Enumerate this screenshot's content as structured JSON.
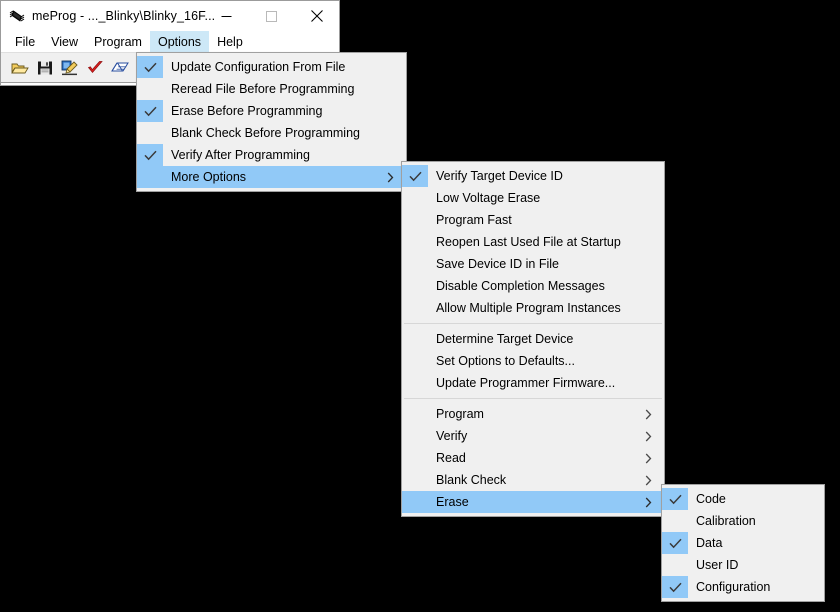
{
  "window": {
    "title": "meProg - ..._Blinky\\Blinky_16F...",
    "icon": "chip-icon",
    "controls": {
      "minimize": "minimize-icon",
      "maximize": "maximize-icon",
      "close": "close-icon"
    }
  },
  "menubar": {
    "items": [
      {
        "label": "File",
        "active": false
      },
      {
        "label": "View",
        "active": false
      },
      {
        "label": "Program",
        "active": false
      },
      {
        "label": "Options",
        "active": true
      },
      {
        "label": "Help",
        "active": false
      }
    ]
  },
  "toolbar": {
    "items": [
      {
        "name": "open-file-icon"
      },
      {
        "name": "save-file-icon"
      },
      {
        "name": "program-device-icon"
      },
      {
        "name": "verify-icon"
      },
      {
        "name": "read-icon"
      },
      {
        "name": "blank-check-icon"
      }
    ]
  },
  "menus": {
    "options": {
      "name": "options-menu",
      "items": [
        {
          "label": "Update Configuration From File",
          "checked": true,
          "selected": false,
          "submenu": false
        },
        {
          "label": "Reread File Before Programming",
          "checked": false,
          "selected": false,
          "submenu": false
        },
        {
          "label": "Erase Before Programming",
          "checked": true,
          "selected": false,
          "submenu": false
        },
        {
          "label": "Blank Check Before Programming",
          "checked": false,
          "selected": false,
          "submenu": false
        },
        {
          "label": "Verify After Programming",
          "checked": true,
          "selected": false,
          "submenu": false
        },
        {
          "label": "More Options",
          "checked": false,
          "selected": true,
          "submenu": true
        }
      ]
    },
    "more_options": {
      "name": "more-options-submenu",
      "items": [
        {
          "label": "Verify Target Device ID",
          "checked": true,
          "selected": false,
          "submenu": false,
          "separator_after": false
        },
        {
          "label": "Low Voltage Erase",
          "checked": false,
          "selected": false,
          "submenu": false,
          "separator_after": false
        },
        {
          "label": "Program Fast",
          "checked": false,
          "selected": false,
          "submenu": false,
          "separator_after": false
        },
        {
          "label": "Reopen Last Used File at Startup",
          "checked": false,
          "selected": false,
          "submenu": false,
          "separator_after": false
        },
        {
          "label": "Save Device ID in File",
          "checked": false,
          "selected": false,
          "submenu": false,
          "separator_after": false
        },
        {
          "label": "Disable Completion Messages",
          "checked": false,
          "selected": false,
          "submenu": false,
          "separator_after": false
        },
        {
          "label": "Allow Multiple Program Instances",
          "checked": false,
          "selected": false,
          "submenu": false,
          "separator_after": true
        },
        {
          "label": "Determine Target Device",
          "checked": false,
          "selected": false,
          "submenu": false,
          "separator_after": false
        },
        {
          "label": "Set Options to Defaults...",
          "checked": false,
          "selected": false,
          "submenu": false,
          "separator_after": false
        },
        {
          "label": "Update Programmer Firmware...",
          "checked": false,
          "selected": false,
          "submenu": false,
          "separator_after": true
        },
        {
          "label": "Program",
          "checked": false,
          "selected": false,
          "submenu": true,
          "separator_after": false
        },
        {
          "label": "Verify",
          "checked": false,
          "selected": false,
          "submenu": true,
          "separator_after": false
        },
        {
          "label": "Read",
          "checked": false,
          "selected": false,
          "submenu": true,
          "separator_after": false
        },
        {
          "label": "Blank Check",
          "checked": false,
          "selected": false,
          "submenu": true,
          "separator_after": false
        },
        {
          "label": "Erase",
          "checked": false,
          "selected": true,
          "submenu": true,
          "separator_after": false
        }
      ]
    },
    "erase": {
      "name": "erase-submenu",
      "items": [
        {
          "label": "Code",
          "checked": true,
          "selected": false,
          "submenu": false
        },
        {
          "label": "Calibration",
          "checked": false,
          "selected": false,
          "submenu": false
        },
        {
          "label": "Data",
          "checked": true,
          "selected": false,
          "submenu": false
        },
        {
          "label": "User ID",
          "checked": false,
          "selected": false,
          "submenu": false
        },
        {
          "label": "Configuration",
          "checked": true,
          "selected": false,
          "submenu": false
        }
      ]
    }
  },
  "glyphs": {
    "checkmark": "✓",
    "chevron_right": "›"
  },
  "colors": {
    "menu_background": "#f0f0f0",
    "highlight": "#91c9f7",
    "menubar_highlight": "#cde8f7",
    "toolbar_background": "#f0f0f0",
    "text": "#000000",
    "separator": "#d7d7d7",
    "desktop": "#000000"
  }
}
